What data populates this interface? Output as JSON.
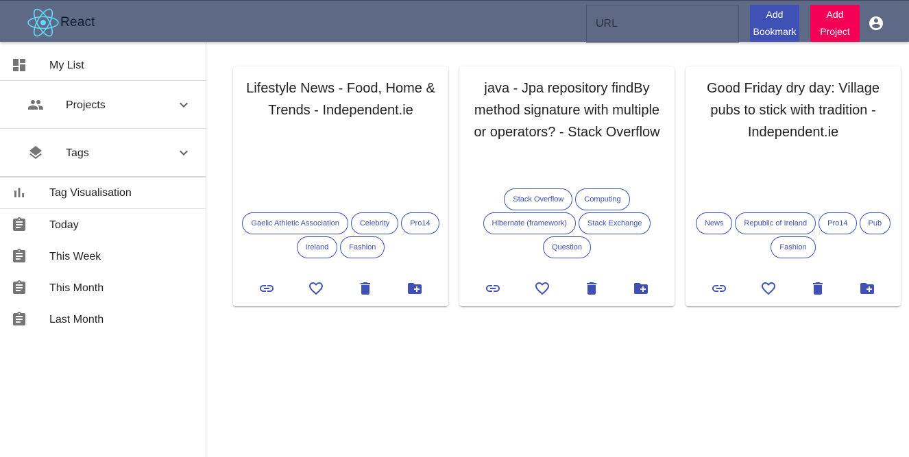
{
  "header": {
    "logo_text": "React",
    "url_input": {
      "placeholder": "URL",
      "value": ""
    },
    "add_bookmark_label": "Add Bookmark",
    "add_project_label": "Add Project",
    "accent": "#3f51b5",
    "secondary": "#f50057"
  },
  "sidebar": {
    "my_list": "My List",
    "projects": "Projects",
    "tags": "Tags",
    "tag_visualisation": "Tag Visualisation",
    "today": "Today",
    "this_week": "This Week",
    "this_month": "This Month",
    "last_month": "Last Month"
  },
  "cards": [
    {
      "title": "Lifestyle News - Food, Home & Trends - Independent.ie",
      "tags": [
        "Gaelic Athletic Association",
        "Celebrity",
        "Pro14",
        "Ireland",
        "Fashion"
      ]
    },
    {
      "title": "java - Jpa repository findBy method signature with multiple or operators? - Stack Overflow",
      "tags": [
        "Stack Overflow",
        "Computing",
        "Hibernate (framework)",
        "Stack Exchange",
        "Question"
      ]
    },
    {
      "title": "Good Friday dry day: Village pubs to stick with tradition - Independent.ie",
      "tags": [
        "News",
        "Republic of Ireland",
        "Pro14",
        "Pub",
        "Fashion"
      ]
    }
  ],
  "card_actions": [
    "link-icon",
    "heart-icon",
    "delete-icon",
    "create-new-folder-icon"
  ]
}
